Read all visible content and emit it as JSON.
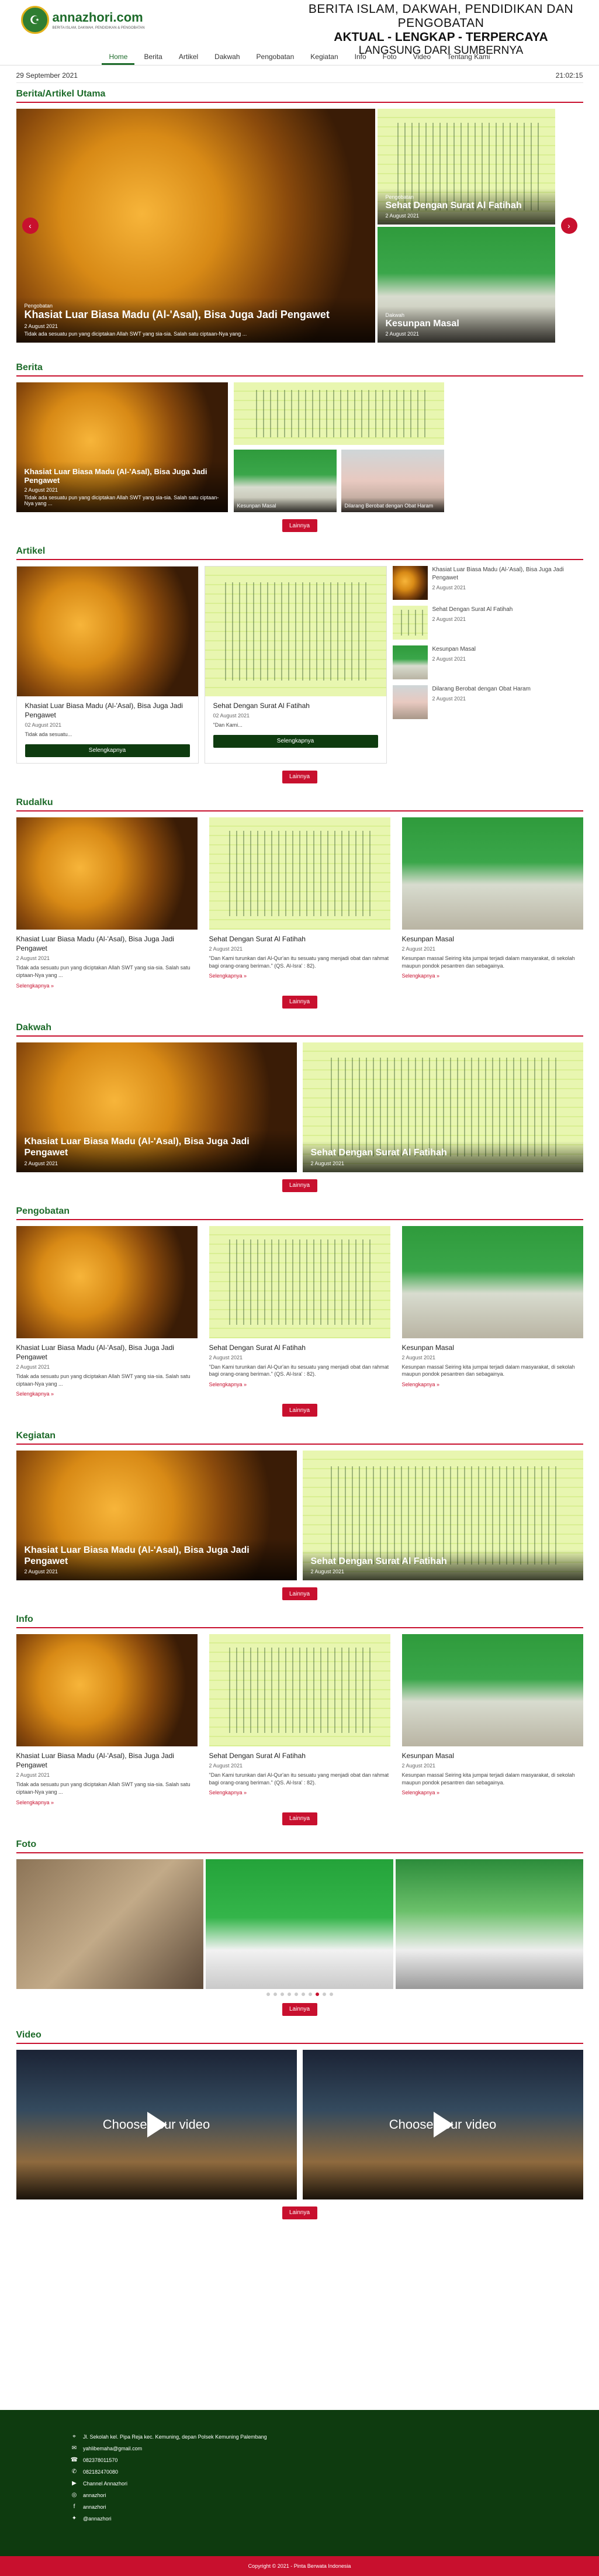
{
  "site": {
    "logo_name": "annazhori.com",
    "logo_sub": "BERITA ISLAM, DAKWAH, PENDIDIKAN & PENGOBATAN",
    "tagline1": "BERITA ISLAM, DAKWAH, PENDIDIKAN DAN PENGOBATAN",
    "tagline2": "AKTUAL - LENGKAP - TERPERCAYA",
    "tagline3": "LANGSUNG DARI SUMBERNYA"
  },
  "nav": [
    "Home",
    "Berita",
    "Artikel",
    "Dakwah",
    "Pengobatan",
    "Kegiatan",
    "Info",
    "Foto",
    "Video",
    "Tentang Kami"
  ],
  "date": "29 September 2021",
  "time": "21:02:15",
  "more_label": "Lainnya",
  "sections": {
    "utama": "Berita/Artikel Utama",
    "berita": "Berita",
    "artikel": "Artikel",
    "rudalku": "Rudalku",
    "dakwah": "Dakwah",
    "pengobatan": "Pengobatan",
    "kegiatan": "Kegiatan",
    "info": "Info",
    "foto": "Foto",
    "video": "Video"
  },
  "posts": {
    "madu": {
      "category": "Pengobatan",
      "title": "Khasiat Luar Biasa Madu (Al-'Asal), Bisa Juga Jadi Pengawet",
      "date": "2 August 2021",
      "excerpt": "Tidak ada sesuatu pun yang diciptakan Allah SWT yang sia-sia. Salah satu ciptaan-Nya yang ..."
    },
    "fatihah": {
      "category": "Pengobatan",
      "title": "Sehat Dengan Surat Al Fatihah",
      "date": "2 August 2021",
      "excerpt": "\"Dan Kami turunkan dari Al-Qur'an itu sesuatu yang menjadi obat dan rahmat bagi orang-orang beriman.\" (QS. Al-Isra' : 82)."
    },
    "masal": {
      "category": "Dakwah",
      "title": "Kesunpan Masal",
      "date": "2 August 2021",
      "excerpt": "Kesunpan massal Seiring kita jumpai terjadi dalam masyarakat, di sekolah maupun pondok pesantren dan sebagainya."
    },
    "hewan": {
      "title": "Dilarang Berobat dengan Obat Haram",
      "date": "2 August 2021"
    }
  },
  "artikel_sidebar": [
    {
      "title": "Khasiat Luar Biasa Madu (Al-'Asal), Bisa Juga Jadi Pengawet",
      "date": "2 August 2021"
    },
    {
      "title": "Sehat Dengan Surat Al Fatihah",
      "date": "2 August 2021"
    },
    {
      "title": "Kesunpan Masal",
      "date": "2 August 2021"
    },
    {
      "title": "Dilarang Berobat dengan Obat Haram",
      "date": "2 August 2021"
    }
  ],
  "artikel_cards": [
    {
      "title": "Khasiat Luar Biasa Madu (Al-'Asal), Bisa Juga Jadi Pengawet",
      "date": "02 August 2021",
      "excerpt": "Tidak ada sesuatu...",
      "button": "Selengkapnya"
    },
    {
      "title": "Sehat Dengan Surat Al Fatihah",
      "date": "02 August 2021",
      "excerpt": "\"Dan Kami...",
      "button": "Selengkapnya"
    }
  ],
  "read_more": "Selengkapnya »",
  "video_label": "Choose your video",
  "footer": {
    "address": "Jl. Sekolah kel. Pipa Reja kec. Kemuning, depan Polsek Kemuning Palembang",
    "email": "yahlibemaha@gmail.com",
    "phone": "082378011570",
    "wa": "082182470080",
    "youtube": "Channel Annazhori",
    "instagram": "annazhori",
    "facebook": "annazhori",
    "twitter": "@annazhori",
    "copyright": "Copyright © 2021 - Pinta Berwata Indonesia"
  }
}
